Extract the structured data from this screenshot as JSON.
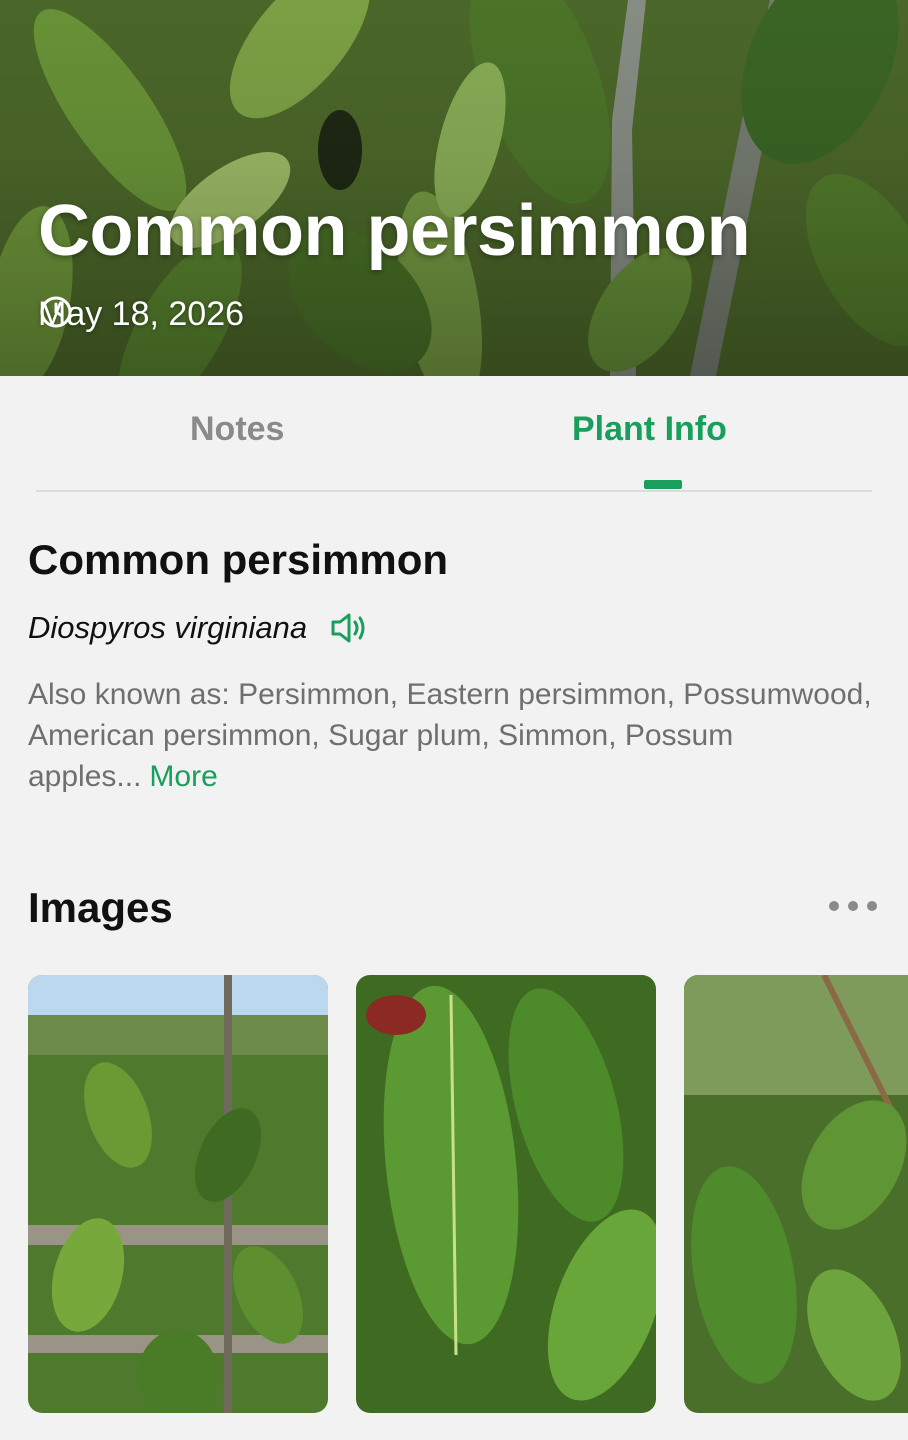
{
  "hero": {
    "title": "Common persimmon",
    "date": "May 18, 2026",
    "clock_icon": "clock-icon"
  },
  "tabs": {
    "notes_label": "Notes",
    "plant_info_label": "Plant Info",
    "active": "Plant Info"
  },
  "plant_info": {
    "common_name": "Common persimmon",
    "scientific_name": "Diospyros virginiana",
    "pronounce_icon": "speaker-icon",
    "also_known_as": "Also known as: Persimmon, Eastern persimmon, Possumwood, American persimmon, Sugar plum, Simmon, Possum apples...",
    "more_label": "More"
  },
  "images_section": {
    "title": "Images",
    "menu_icon": "more-dots-icon",
    "thumbnails": [
      "leafy persimmon sapling by wooden fence",
      "large green persimmon leaves close-up",
      "persimmon branches with leaves"
    ]
  },
  "colors": {
    "accent": "#1a9e5c",
    "background": "#f2f2f2",
    "inactive_tab": "#8a8a8a"
  }
}
